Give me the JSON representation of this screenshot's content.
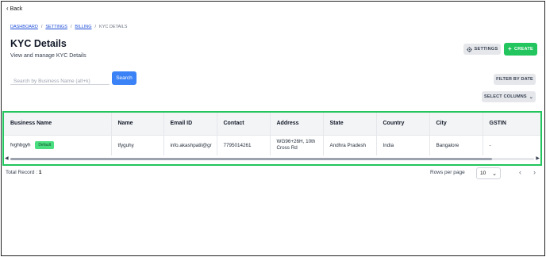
{
  "nav": {
    "back_label": "Back"
  },
  "breadcrumb": [
    "DASHBOARD",
    "SETTINGS",
    "BILLING",
    "KYC DETAILS"
  ],
  "header": {
    "title": "KYC Details",
    "subtitle": "View and manage KYC Details",
    "settings_label": "SETTINGS",
    "create_label": "CREATE"
  },
  "search": {
    "placeholder": "Search by Business Name (alt+k)",
    "value": "",
    "button_label": "Search"
  },
  "filters": {
    "filter_date_label": "FILTER BY DATE",
    "select_columns_label": "SELECT COLUMNS"
  },
  "table": {
    "columns": [
      "Business Name",
      "Name",
      "Email ID",
      "Contact",
      "Address",
      "State",
      "Country",
      "City",
      "GSTIN"
    ],
    "rows": [
      {
        "business_name": "fvghbgyh",
        "badge": "Default",
        "name": "tfyguhy",
        "email": "info.akashpatil@gr",
        "contact": "7795014261",
        "address": "WG96+26H, 10th Cross Rd",
        "state": "Andhra Pradesh",
        "country": "India",
        "city": "Bangalore",
        "gstin": "-"
      }
    ],
    "scroll_fraction": 0.92
  },
  "footer": {
    "total_label": "Total Record :",
    "total_value": "1",
    "rows_per_page_label": "Rows per page",
    "rows_per_page_value": "10"
  },
  "icons": {
    "back": "chevron-left-icon",
    "settings": "gear-icon",
    "create": "plus-icon",
    "select_columns": "chevron-down-icon",
    "rows_select": "chevron-down-icon",
    "prev": "chevron-left-icon",
    "next": "chevron-right-icon"
  },
  "colors": {
    "accent_green": "#22c55e",
    "search_blue": "#3b82f6",
    "badge_green": "#4ade80"
  }
}
